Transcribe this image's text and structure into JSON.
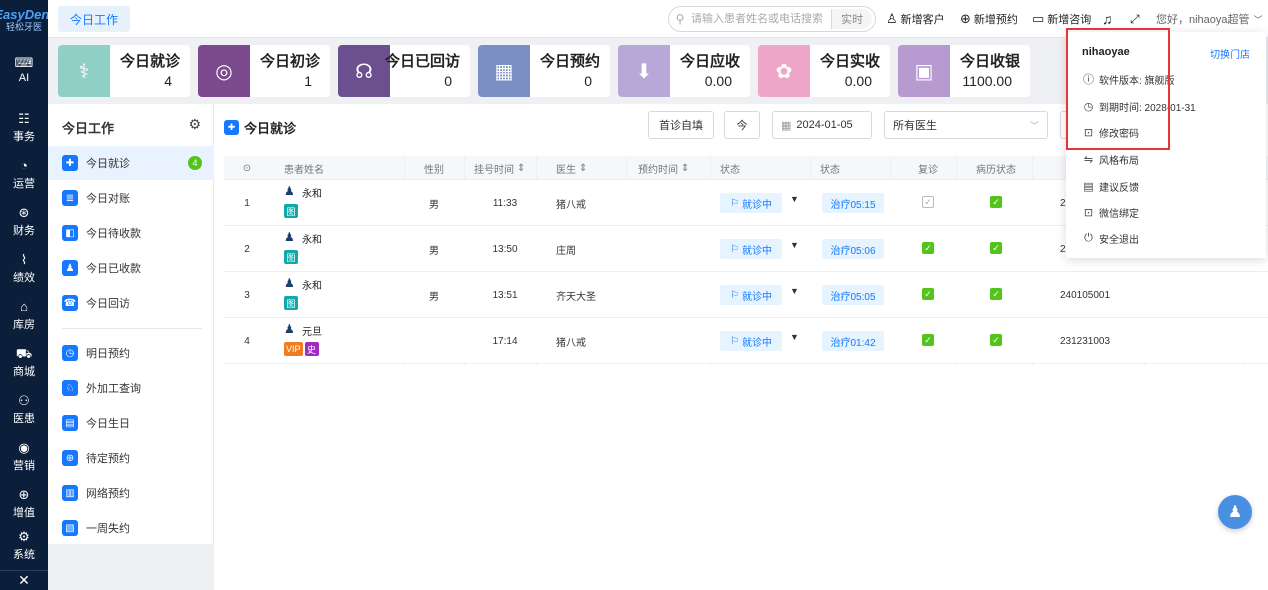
{
  "app": {
    "brand": "EasyDent",
    "subtitle": "轻松牙医"
  },
  "leftnav": [
    {
      "label": "AI",
      "icon": "ai-icon"
    },
    {
      "label": "事务",
      "icon": "task-icon"
    },
    {
      "label": "运营",
      "icon": "operation-icon"
    },
    {
      "label": "财务",
      "icon": "finance-icon"
    },
    {
      "label": "绩效",
      "icon": "chart-icon"
    },
    {
      "label": "库房",
      "icon": "warehouse-icon"
    },
    {
      "label": "商城",
      "icon": "cart-icon"
    },
    {
      "label": "医患",
      "icon": "people-icon"
    },
    {
      "label": "营销",
      "icon": "marketing-icon"
    },
    {
      "label": "增值",
      "icon": "value-icon"
    },
    {
      "label": "系统",
      "icon": "settings-icon"
    }
  ],
  "topbar": {
    "tab": "今日工作",
    "search_placeholder": "请输入患者姓名或电话搜索",
    "search_mode": "实时",
    "new_customer": "新增客户",
    "new_appointment": "新增预约",
    "new_consult": "新增咨询",
    "greeting": "您好，nihaoya超管"
  },
  "stats": [
    {
      "title": "今日就诊",
      "value": "4",
      "color": "#8fd0c6",
      "icon": "doctor-icon"
    },
    {
      "title": "今日初诊",
      "value": "1",
      "color": "#7a4a8c",
      "icon": "first-visit-icon"
    },
    {
      "title": "今日已回访",
      "value": "0",
      "color": "#6b4f8f",
      "icon": "headset-icon"
    },
    {
      "title": "今日预约",
      "value": "0",
      "color": "#7b8fc5",
      "icon": "calendar-icon"
    },
    {
      "title": "今日应收",
      "value": "0.00",
      "color": "#b8a8d8",
      "icon": "download-icon"
    },
    {
      "title": "今日实收",
      "value": "0.00",
      "color": "#f0a6c9",
      "icon": "hand-money-icon"
    },
    {
      "title": "今日收银",
      "value": "1100.00",
      "color": "#b69ad0",
      "icon": "cashier-icon"
    }
  ],
  "side": {
    "title": "今日工作",
    "items": [
      {
        "label": "今日就诊",
        "badge": "4",
        "icon": "visit-icon"
      },
      {
        "label": "今日对账",
        "icon": "ledger-icon"
      },
      {
        "label": "今日待收款",
        "icon": "pending-pay-icon"
      },
      {
        "label": "今日已收款",
        "icon": "paid-icon"
      },
      {
        "label": "今日回访",
        "icon": "revisit-icon"
      },
      {
        "label": "明日预约",
        "icon": "tomorrow-icon"
      },
      {
        "label": "外加工查询",
        "icon": "outsource-icon"
      },
      {
        "label": "今日生日",
        "icon": "birthday-icon"
      },
      {
        "label": "待定预约",
        "icon": "pending-appt-icon"
      },
      {
        "label": "网络预约",
        "icon": "online-appt-icon"
      },
      {
        "label": "一周失约",
        "icon": "missed-icon"
      }
    ]
  },
  "main": {
    "title": "今日就诊",
    "btn_self": "首诊自填",
    "btn_today": "今",
    "date": "2024-01-05",
    "doctor_select": "所有医生",
    "columns": [
      "患者姓名",
      "性别",
      "挂号时间",
      "医生",
      "预约时间",
      "状态",
      "状态",
      "复诊",
      "病历状态"
    ],
    "rows": [
      {
        "no": "1",
        "name": "永和",
        "tags": [
          "图"
        ],
        "gender": "男",
        "time": "11:33",
        "doctor": "猪八戒",
        "appt": "",
        "status": "就诊中",
        "treat": "治疗05:15",
        "revisit": false,
        "record": true,
        "code": "2"
      },
      {
        "no": "2",
        "name": "永和",
        "tags": [
          "图"
        ],
        "gender": "男",
        "time": "13:50",
        "doctor": "庄周",
        "appt": "",
        "status": "就诊中",
        "treat": "治疗05:06",
        "revisit": true,
        "record": true,
        "code": "2"
      },
      {
        "no": "3",
        "name": "永和",
        "tags": [
          "图"
        ],
        "gender": "男",
        "time": "13:51",
        "doctor": "齐天大圣",
        "appt": "",
        "status": "就诊中",
        "treat": "治疗05:05",
        "revisit": true,
        "record": true,
        "code": "240105001"
      },
      {
        "no": "4",
        "name": "元旦",
        "tags": [
          "VIP",
          "史"
        ],
        "gender": "",
        "time": "17:14",
        "doctor": "猪八戒",
        "appt": "",
        "status": "就诊中",
        "treat": "治疗01:42",
        "revisit": true,
        "record": true,
        "code": "231231003"
      }
    ]
  },
  "dropdown": {
    "user": "nihaoyae",
    "switch_store": "切换门店",
    "items": [
      {
        "label": "软件版本: 旗舰版",
        "icon": "info-icon"
      },
      {
        "label": "到期时间: 2028-01-31",
        "icon": "clock-icon"
      },
      {
        "label": "修改密码",
        "icon": "lock-icon"
      },
      {
        "label": "风格布局",
        "icon": "layout-icon"
      },
      {
        "label": "建议反馈",
        "icon": "feedback-icon"
      },
      {
        "label": "微信绑定",
        "icon": "wechat-lock-icon"
      },
      {
        "label": "安全退出",
        "icon": "power-icon"
      }
    ]
  }
}
